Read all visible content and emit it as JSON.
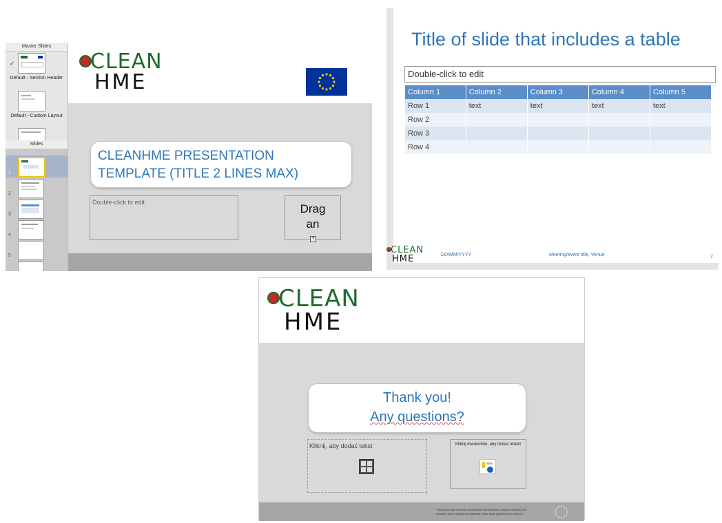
{
  "sidebar": {
    "master_header": "Master Slides",
    "master_items": [
      {
        "label": "Default - Section Header"
      },
      {
        "label": "Default - Custom Layout"
      }
    ],
    "slides_header": "Slides",
    "slide_numbers": [
      "1",
      "2",
      "3",
      "4",
      "5"
    ]
  },
  "logo": {
    "line1": "CLEAN",
    "line2": "HME"
  },
  "editor_slide": {
    "title_line1": "CLEANHME PRESENTATION",
    "title_line2": "TEMPLATE (TITLE 2 LINES MAX)",
    "text_placeholder": "Double-click to edit",
    "object_placeholder_line1": "Drag",
    "object_placeholder_line2": "an"
  },
  "table_slide": {
    "title": "Title of slide that includes a table",
    "edit_placeholder": "Double-click to edit",
    "columns": [
      "Column 1",
      "Column 2",
      "Column 3",
      "Column 4",
      "Column 5"
    ],
    "rows": [
      [
        "Row 1",
        "text",
        "text",
        "text",
        "text"
      ],
      [
        "Row 2",
        "",
        "",
        "",
        ""
      ],
      [
        "Row 3",
        "",
        "",
        "",
        ""
      ],
      [
        "Row 4",
        "",
        "",
        "",
        ""
      ]
    ],
    "footer": {
      "date": "DD/MM/YYYY",
      "event": "Meeting/event title, Venue",
      "page": "7"
    }
  },
  "thanks_slide": {
    "line1": "Thank you!",
    "line2": "Any questions?",
    "text_placeholder": "Kliknij, aby dodać tekst",
    "object_placeholder": "Kliknij dwukrotnie, aby dodać obiekt",
    "funding_line1": "This project has received funding from the European Union's Horizon2020",
    "funding_line2": "research and innovation programme under grant agreement no 951974"
  },
  "colors": {
    "title_blue": "#2e75b6",
    "table_header": "#5b8dc9",
    "logo_green": "#1e6b2b"
  }
}
